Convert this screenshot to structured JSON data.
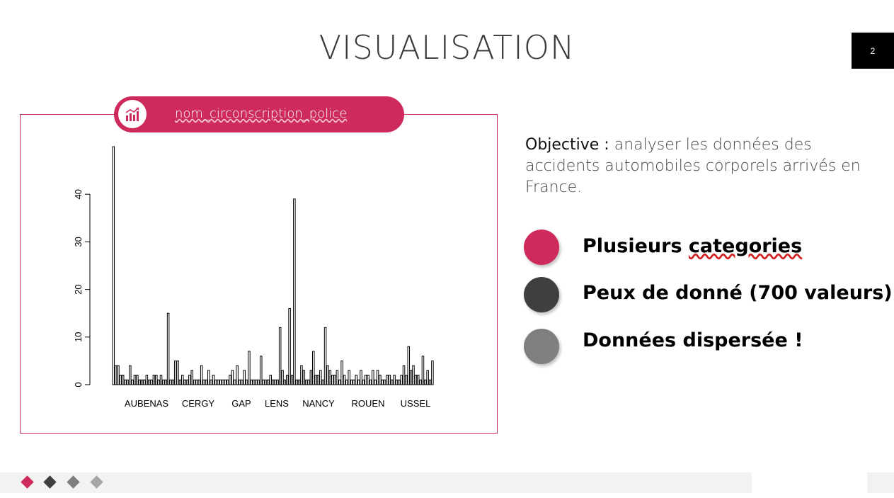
{
  "slide": {
    "title": "VISUALISATION",
    "page_number": "2"
  },
  "chart_panel": {
    "label": "nom_circonscription_police",
    "icon": "chart-growth-icon"
  },
  "objective": {
    "label": "Objective :",
    "text": "analyser les données des accidents automobiles corporels arrivés en France."
  },
  "bullets": [
    {
      "pre": "Plusieurs ",
      "marked": "categories",
      "color": "#cf2a5c"
    },
    {
      "pre": "Peux de donné (700 valeurs)",
      "marked": "",
      "color": "#3f3f3f"
    },
    {
      "pre": "Données dispersée !",
      "marked": "",
      "color": "#7f7f7f"
    }
  ],
  "footer": {
    "diamond_colors": [
      "#cf2a5c",
      "#3f3f3f",
      "#7f7f7f",
      "#a6a6a6"
    ]
  },
  "colors": {
    "accent": "#cf2a5c",
    "dark": "#3f3f3f"
  },
  "chart_data": {
    "type": "bar",
    "title": "",
    "xlabel": "",
    "ylabel": "",
    "ylim": [
      0,
      50
    ],
    "yticks": [
      0,
      10,
      20,
      30,
      40
    ],
    "x_tick_labels": [
      "AUBENAS",
      "CERGY",
      "GAP",
      "LENS",
      "NANCY",
      "ROUEN",
      "USSEL"
    ],
    "values": [
      50,
      4,
      4,
      2,
      2,
      1,
      1,
      4,
      1,
      2,
      2,
      1,
      1,
      1,
      2,
      1,
      1,
      2,
      2,
      1,
      2,
      1,
      1,
      15,
      1,
      1,
      5,
      5,
      1,
      2,
      1,
      1,
      2,
      3,
      1,
      1,
      1,
      4,
      1,
      1,
      3,
      1,
      2,
      1,
      1,
      1,
      1,
      1,
      1,
      2,
      3,
      1,
      4,
      1,
      1,
      3,
      1,
      7,
      1,
      1,
      1,
      1,
      6,
      1,
      1,
      1,
      2,
      1,
      1,
      1,
      12,
      3,
      1,
      2,
      16,
      2,
      39,
      1,
      1,
      4,
      3,
      1,
      1,
      3,
      7,
      2,
      2,
      3,
      1,
      12,
      4,
      3,
      2,
      2,
      3,
      1,
      5,
      2,
      1,
      3,
      1,
      1,
      2,
      1,
      3,
      1,
      2,
      2,
      1,
      3,
      1,
      3,
      2,
      1,
      1,
      2,
      2,
      1,
      2,
      1,
      1,
      2,
      4,
      2,
      8,
      3,
      4,
      2,
      2,
      1,
      6,
      1,
      3,
      1,
      5
    ]
  }
}
